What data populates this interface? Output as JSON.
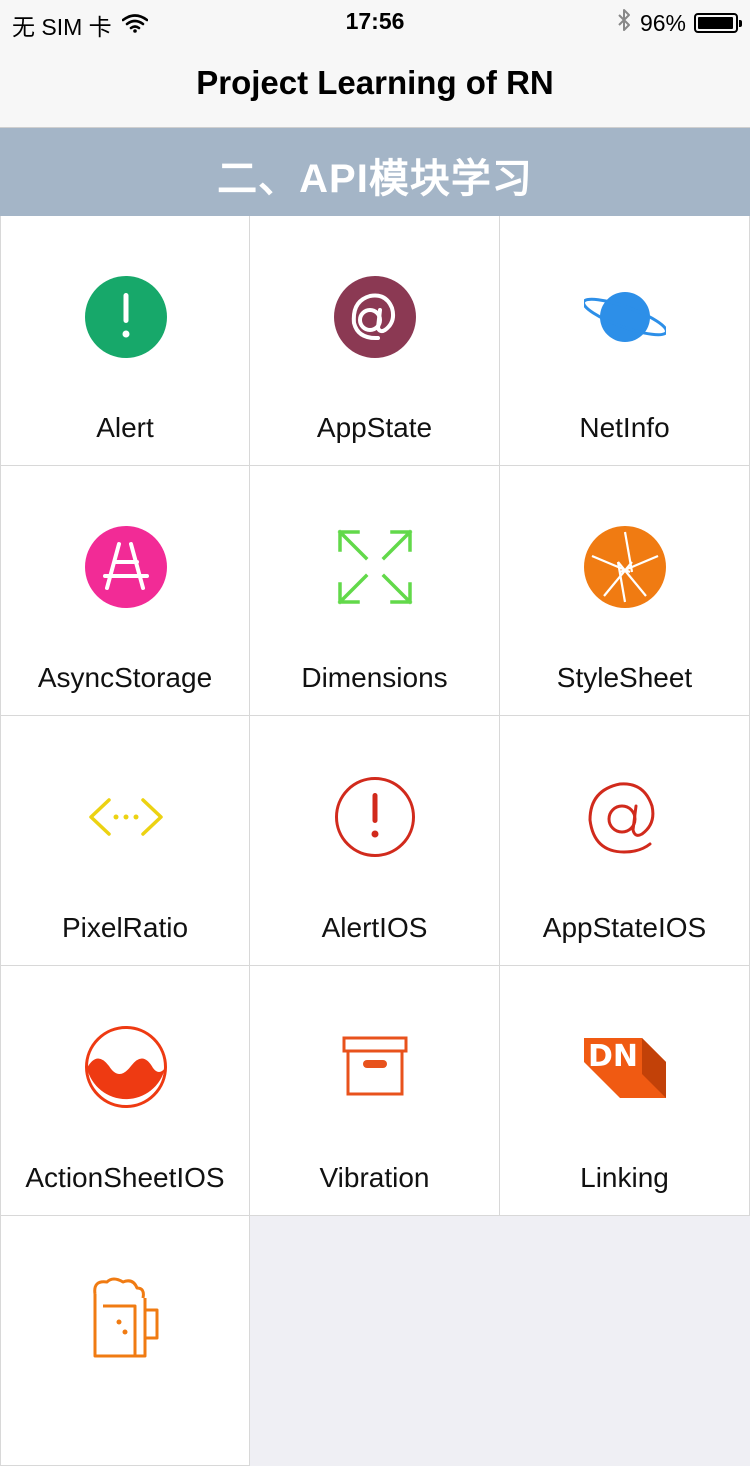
{
  "status_bar": {
    "carrier": "无 SIM 卡",
    "time": "17:56",
    "battery_text": "96%",
    "battery_level": 0.96,
    "icons": [
      "wifi-icon",
      "bluetooth-icon",
      "battery-icon"
    ]
  },
  "nav": {
    "title": "Project Learning of RN"
  },
  "section": {
    "title": "二、API模块学习"
  },
  "colors": {
    "section_bg": "#a4b5c7",
    "alert": "#17a86a",
    "appstate": "#8b3953",
    "netinfo": "#2d8fe8",
    "asyncstorage": "#f22b96",
    "dimensions": "#62d94a",
    "stylesheet": "#f07b12",
    "pixelratio": "#ecd212",
    "alertios": "#d12a1c",
    "appstateios": "#d12a1c",
    "actionsheetios": "#ee3a12",
    "vibration": "#e8521c",
    "linking": "#f05a12",
    "last": "#f07b12"
  },
  "grid": {
    "items": [
      {
        "label": "Alert",
        "icon": "alert-circle-icon"
      },
      {
        "label": "AppState",
        "icon": "at-sign-circle-icon"
      },
      {
        "label": "NetInfo",
        "icon": "planet-icon"
      },
      {
        "label": "AsyncStorage",
        "icon": "app-store-icon"
      },
      {
        "label": "Dimensions",
        "icon": "expand-arrows-icon"
      },
      {
        "label": "StyleSheet",
        "icon": "aperture-icon"
      },
      {
        "label": "PixelRatio",
        "icon": "code-brackets-icon"
      },
      {
        "label": "AlertIOS",
        "icon": "alert-outline-icon"
      },
      {
        "label": "AppStateIOS",
        "icon": "at-sign-icon"
      },
      {
        "label": "ActionSheetIOS",
        "icon": "wave-circle-icon"
      },
      {
        "label": "Vibration",
        "icon": "archive-box-icon"
      },
      {
        "label": "Linking",
        "icon": "dn-logo-icon"
      },
      {
        "label": "",
        "icon": "beer-mug-icon"
      }
    ]
  }
}
